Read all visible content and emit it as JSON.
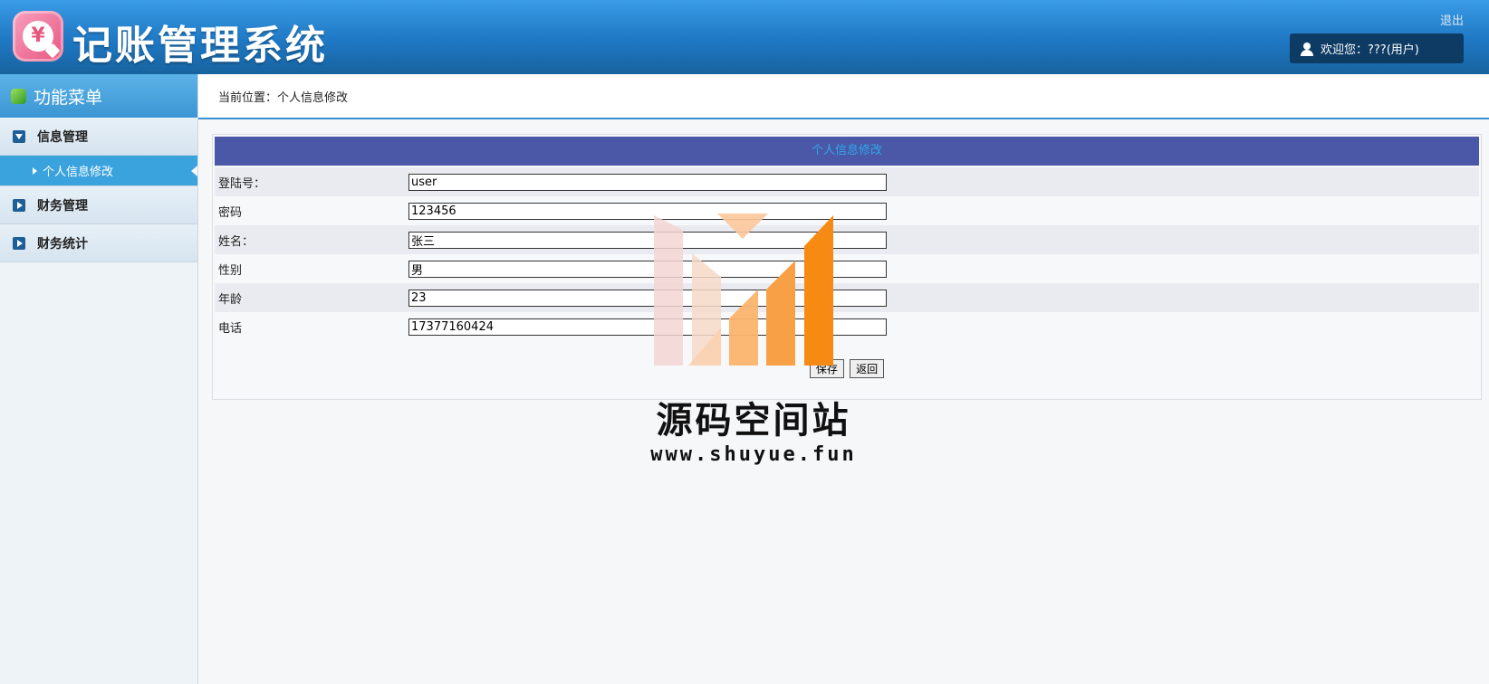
{
  "header": {
    "app_title": "记账管理系统",
    "logo_glyph": "¥",
    "logout_label": "退出",
    "welcome_text": "欢迎您：???(用户)"
  },
  "sidebar": {
    "title": "功能菜单",
    "groups": [
      {
        "label": "信息管理",
        "expanded": true,
        "items": [
          {
            "label": "个人信息修改",
            "active": true
          }
        ]
      },
      {
        "label": "财务管理",
        "expanded": false
      },
      {
        "label": "财务统计",
        "expanded": false
      }
    ]
  },
  "breadcrumb": {
    "text": "当前位置：个人信息修改"
  },
  "form": {
    "title": "个人信息修改",
    "fields": [
      {
        "label": "登陆号：",
        "value": "user"
      },
      {
        "label": "密码",
        "value": "123456"
      },
      {
        "label": "姓名：",
        "value": "张三"
      },
      {
        "label": "性别",
        "value": "男"
      },
      {
        "label": "年龄",
        "value": "23"
      },
      {
        "label": "电话",
        "value": "17377160424"
      }
    ],
    "save_label": "保存",
    "back_label": "返回"
  },
  "watermark": {
    "title": "源码空间站",
    "url": "www.shuyue.fun"
  },
  "colors": {
    "header_blue": "#1f78c4",
    "panel_title_bg": "#4b58a8",
    "panel_title_text": "#2fa7e8",
    "active_item_bg": "#3aa3de"
  }
}
